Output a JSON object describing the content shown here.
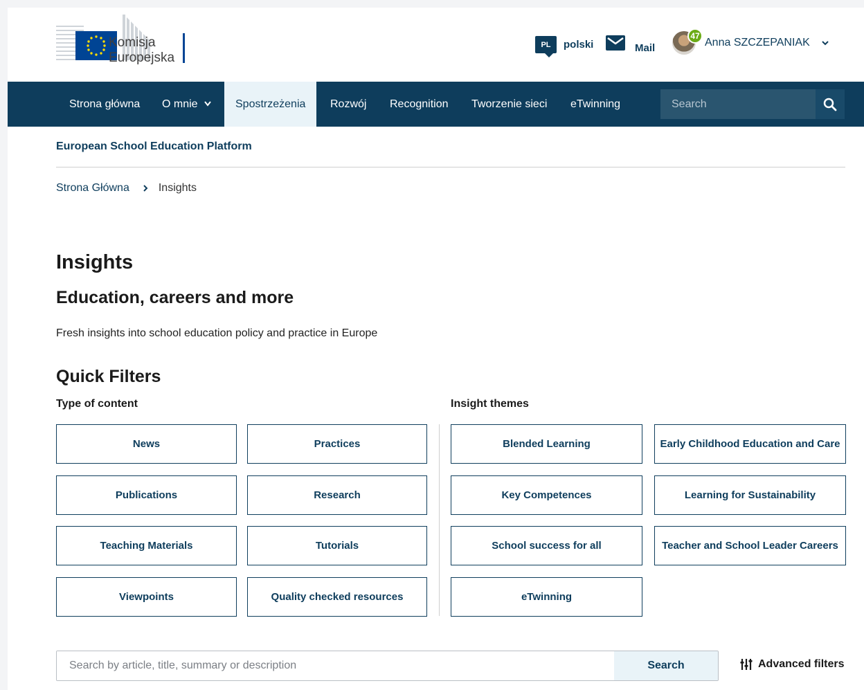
{
  "header": {
    "logo_text_line1": "Komisja",
    "logo_text_line2": "Europejska",
    "lang_code": "PL",
    "lang_label": "polski",
    "mail_label": "Mail",
    "notification_count": "47",
    "user_name": "Anna SZCZEPANIAK"
  },
  "nav": {
    "items": [
      {
        "label": "Strona główna"
      },
      {
        "label": "O mnie"
      },
      {
        "label": "Spostrzeżenia"
      },
      {
        "label": "Rozwój"
      },
      {
        "label": "Recognition"
      },
      {
        "label": "Tworzenie sieci"
      },
      {
        "label": "eTwinning"
      }
    ],
    "active_item": "Spostrzeżenia",
    "search_placeholder": "Search"
  },
  "site_name": "European School Education Platform",
  "breadcrumb": {
    "home": "Strona Główna",
    "current": "Insights"
  },
  "page": {
    "title": "Insights",
    "subtitle": "Education, careers and more",
    "description": "Fresh insights into school education policy and practice in Europe"
  },
  "quick_filters": {
    "title": "Quick Filters",
    "type_of_content": {
      "label": "Type of content",
      "buttons": [
        "News",
        "Practices",
        "Publications",
        "Research",
        "Teaching Materials",
        "Tutorials",
        "Viewpoints",
        "Quality checked resources"
      ]
    },
    "insight_themes": {
      "label": "Insight themes",
      "buttons": [
        "Blended Learning",
        "Early Childhood Education and Care",
        "Key Competences",
        "Learning for Sustainability",
        "School success for all",
        "Teacher and School Leader Careers",
        "eTwinning"
      ]
    }
  },
  "search": {
    "placeholder": "Search by article, title, summary or description",
    "button_label": "Search",
    "advanced_label": "Advanced filters"
  },
  "colors": {
    "brand_dark": "#0e3d5c",
    "nav_active_bg": "#e9f3f8",
    "notification_green": "#6bab16",
    "eu_blue": "#004494",
    "eu_yellow": "#ffdd00"
  }
}
